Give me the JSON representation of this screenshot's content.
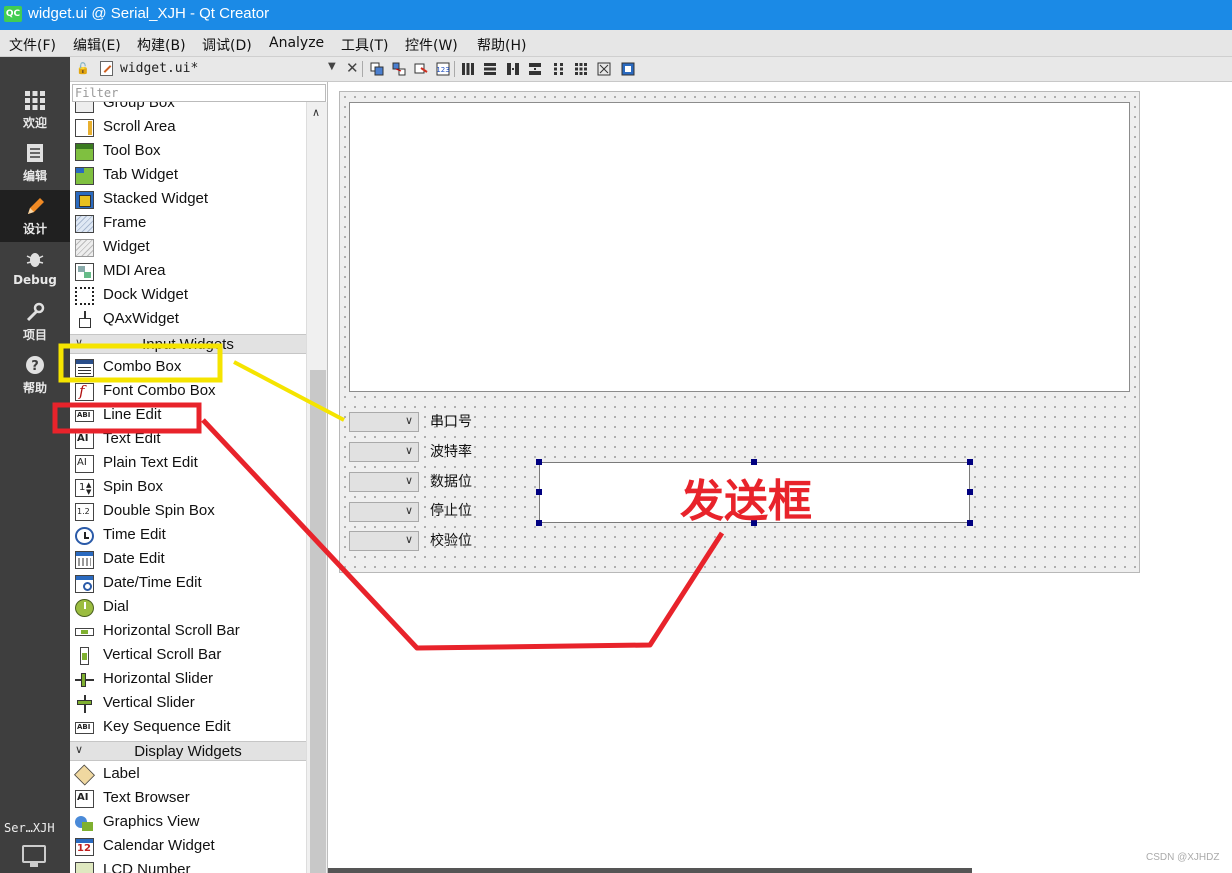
{
  "window": {
    "title": "widget.ui @ Serial_XJH - Qt Creator",
    "logo_text": "QC"
  },
  "menu": [
    "文件(F)",
    "编辑(E)",
    "构建(B)",
    "调试(D)",
    "Analyze",
    "工具(T)",
    "控件(W)",
    "帮助(H)"
  ],
  "modes": [
    {
      "label": "欢迎",
      "icon": "grid-icon"
    },
    {
      "label": "编辑",
      "icon": "document-icon"
    },
    {
      "label": "设计",
      "icon": "pencil-icon",
      "active": true
    },
    {
      "label": "Debug",
      "icon": "bug-icon"
    },
    {
      "label": "项目",
      "icon": "wrench-icon"
    },
    {
      "label": "帮助",
      "icon": "help-icon"
    }
  ],
  "project_selector": {
    "label": "Ser…XJH"
  },
  "editor": {
    "file_tab": "widget.ui*"
  },
  "widget_box": {
    "filter_placeholder": "Filter",
    "items_containers": [
      "Group Box",
      "Scroll Area",
      "Tool Box",
      "Tab Widget",
      "Stacked Widget",
      "Frame",
      "Widget",
      "MDI Area",
      "Dock Widget",
      "QAxWidget"
    ],
    "category_input": "Input Widgets",
    "items_input": [
      "Combo Box",
      "Font Combo Box",
      "Line Edit",
      "Text Edit",
      "Plain Text Edit",
      "Spin Box",
      "Double Spin Box",
      "Time Edit",
      "Date Edit",
      "Date/Time Edit",
      "Dial",
      "Horizontal Scroll Bar",
      "Vertical Scroll Bar",
      "Horizontal Slider",
      "Vertical Slider",
      "Key Sequence Edit"
    ],
    "category_display": "Display Widgets",
    "items_display": [
      "Label",
      "Text Browser",
      "Graphics View",
      "Calendar Widget",
      "LCD Number"
    ]
  },
  "form": {
    "combo_labels": [
      "串口号",
      "波特率",
      "数据位",
      "停止位",
      "校验位"
    ],
    "send_annotation": "发送框"
  },
  "annotation_colors": {
    "yellow": "#f5e400",
    "red": "#e8232b"
  },
  "watermark": "CSDN @XJHDZ"
}
